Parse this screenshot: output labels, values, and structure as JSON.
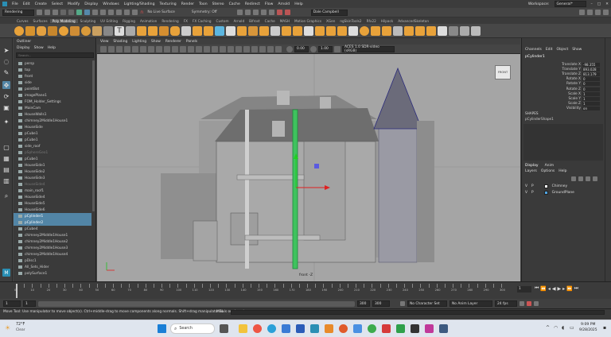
{
  "menubar": {
    "items": [
      "File",
      "Edit",
      "Create",
      "Select",
      "Modify",
      "Display",
      "Windows",
      "Lighting/Shading",
      "Texturing",
      "Render",
      "Toon",
      "Stereo",
      "Cache",
      "Redirect",
      "Flow",
      "Arnold",
      "Help"
    ],
    "workspace_label": "Workspace:",
    "workspace_value": "General*"
  },
  "statusline": {
    "mode": "Rendering",
    "no_live_surface": "No Live Surface",
    "symmetry": "Symmetry: Off",
    "user": "Dale Campbell"
  },
  "shelf": {
    "tabs": [
      "Curves",
      "Surfaces",
      "Poly Modeling",
      "Sculpting",
      "UV Editing",
      "Rigging",
      "Animation",
      "Rendering",
      "FX",
      "FX Caching",
      "Custom",
      "Arnold",
      "Bifrost",
      "Cache",
      "MASH",
      "Motion Graphics",
      "XGen",
      "ngSkinTools2",
      "Rfx22",
      "Hilpack",
      "AdvancedSkeleton"
    ],
    "active_tab": "Poly Modeling"
  },
  "outliner": {
    "title": "Outliner",
    "menu": [
      "Display",
      "Show",
      "Help"
    ],
    "search_placeholder": "Search...",
    "items": [
      {
        "label": "persp",
        "selected": false,
        "dim": false
      },
      {
        "label": "top",
        "selected": false,
        "dim": false
      },
      {
        "label": "front",
        "selected": false,
        "dim": false
      },
      {
        "label": "side",
        "selected": false,
        "dim": false
      },
      {
        "label": "pointBot",
        "selected": false,
        "dim": false
      },
      {
        "label": "imagePlane1",
        "selected": false,
        "dim": false
      },
      {
        "label": "FOM_Holder_Settings",
        "selected": false,
        "dim": false
      },
      {
        "label": "MainCam",
        "selected": false,
        "dim": false
      },
      {
        "label": "HouseWalls1",
        "selected": false,
        "dim": false
      },
      {
        "label": "chimney2Middle1House1",
        "selected": false,
        "dim": false
      },
      {
        "label": "HouseSide",
        "selected": false,
        "dim": false
      },
      {
        "label": "pCube1",
        "selected": false,
        "dim": false
      },
      {
        "label": "pCube1",
        "selected": false,
        "dim": false
      },
      {
        "label": "side_roof",
        "selected": false,
        "dim": false
      },
      {
        "label": "pSphereGeo1",
        "selected": false,
        "dim": true
      },
      {
        "label": "pCube1",
        "selected": false,
        "dim": false
      },
      {
        "label": "HouseSide1",
        "selected": false,
        "dim": false
      },
      {
        "label": "HouseSide2",
        "selected": false,
        "dim": false
      },
      {
        "label": "HouseSide3",
        "selected": false,
        "dim": false
      },
      {
        "label": "HouseSide4",
        "selected": false,
        "dim": true
      },
      {
        "label": "main_roof1",
        "selected": false,
        "dim": false
      },
      {
        "label": "HouseSide4",
        "selected": false,
        "dim": false
      },
      {
        "label": "HouseSide5",
        "selected": false,
        "dim": false
      },
      {
        "label": "HouseSide6",
        "selected": false,
        "dim": false
      },
      {
        "label": "pCylinder1",
        "selected": true,
        "dim": false
      },
      {
        "label": "pCylinder2",
        "selected": true,
        "dim": false
      },
      {
        "label": "pCube4",
        "selected": false,
        "dim": false
      },
      {
        "label": "chimney2Middle1House1",
        "selected": false,
        "dim": false
      },
      {
        "label": "chimney2Middle1House2",
        "selected": false,
        "dim": false
      },
      {
        "label": "chimney2Middle1House3",
        "selected": false,
        "dim": false
      },
      {
        "label": "chimney2Middle1House4",
        "selected": false,
        "dim": false
      },
      {
        "label": "pDisc1",
        "selected": false,
        "dim": false
      },
      {
        "label": "All_Sets_Hider",
        "selected": false,
        "dim": false
      },
      {
        "label": "polySurface1",
        "selected": false,
        "dim": false
      }
    ]
  },
  "viewport": {
    "menu": [
      "View",
      "Shading",
      "Lighting",
      "Show",
      "Renderer",
      "Panels"
    ],
    "camera_label": "front -Z",
    "cam_badge": "FRONT",
    "field_a": "0.00",
    "field_b": "1.00",
    "colorspace": "ACES 1.0 SDR-video (sRGB)"
  },
  "channelbox": {
    "tabs": [
      "Channels",
      "Edit",
      "Object",
      "Show"
    ],
    "object": "pCylinder1",
    "shapes_label": "SHAPES",
    "shape_name": "pCylinderShape1",
    "attrs": [
      {
        "label": "Translate X",
        "value": "-98.355"
      },
      {
        "label": "Translate Y",
        "value": "893.028"
      },
      {
        "label": "Translate Z",
        "value": "813.179"
      },
      {
        "label": "Rotate X",
        "value": "0"
      },
      {
        "label": "Rotate Y",
        "value": "0"
      },
      {
        "label": "Rotate Z",
        "value": "0"
      },
      {
        "label": "Scale X",
        "value": "1"
      },
      {
        "label": "Scale Y",
        "value": "1"
      },
      {
        "label": "Scale Z",
        "value": "1"
      },
      {
        "label": "Visibility",
        "value": "on"
      }
    ]
  },
  "layers": {
    "tabs": [
      "Display",
      "Anim"
    ],
    "menu": [
      "Layers",
      "Options",
      "Help"
    ],
    "items": [
      {
        "vis": "V",
        "p": "P",
        "name": "Chimney",
        "color": "#ffffff"
      },
      {
        "vis": "V",
        "p": "P",
        "name": "GroundPlane",
        "color": "#4fa3e0"
      }
    ]
  },
  "timeline": {
    "ticks": [
      "0",
      "5",
      "10",
      "15",
      "20",
      "25",
      "30",
      "35",
      "40",
      "45",
      "50",
      "55",
      "60",
      "65",
      "70",
      "75",
      "80",
      "85",
      "90",
      "95",
      "100",
      "105",
      "110",
      "115",
      "120",
      "125",
      "130",
      "135",
      "140",
      "145",
      "150",
      "155",
      "160",
      "165",
      "170",
      "175",
      "180",
      "185",
      "190",
      "195",
      "200",
      "205",
      "210",
      "215",
      "220",
      "225",
      "230",
      "235",
      "240",
      "245",
      "250",
      "255",
      "260",
      "265",
      "270",
      "275",
      "280",
      "285",
      "290",
      "295",
      "300"
    ],
    "current_frame": "1"
  },
  "range": {
    "start": "1",
    "start2": "1",
    "end": "300",
    "end2": "300",
    "char_set": "No Character Set",
    "anim_layer": "No Anim Layer",
    "fps": "24 fps"
  },
  "help_line": "Move Tool: Use manipulator to move object(s). Ctrl+middle-drag to move components along normals. Shift+drag manipulator axis or plane han",
  "mel_label": "MEL",
  "taskbar": {
    "temp": "72°F",
    "weather": "Clear",
    "search": "Search",
    "time": "9:09 PM",
    "date": "9/28/2025"
  },
  "colors": {
    "selection": "#5285a6",
    "viewport_bg": "#a5a5a5",
    "green_pipe": "#3fc25e",
    "accent_orange": "#e8a23a"
  }
}
